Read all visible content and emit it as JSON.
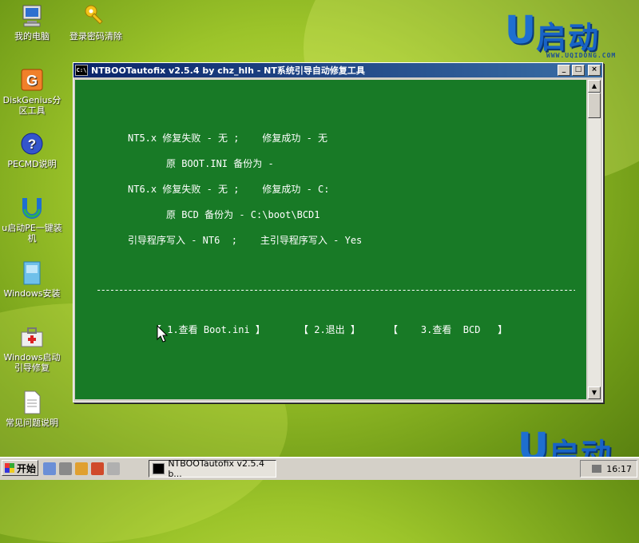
{
  "desktop": {
    "icons": [
      {
        "label": "我的电脑",
        "icon": "computer-icon"
      },
      {
        "label": "登录密码清除",
        "icon": "key-icon"
      },
      {
        "label": "DiskGenius分区工具",
        "icon": "diskgenius-icon"
      },
      {
        "label": "PECMD说明",
        "icon": "help-icon"
      },
      {
        "label": "u启动PE一键装机",
        "icon": "u-logo-icon"
      },
      {
        "label": "Windows安装",
        "icon": "windows-install-icon"
      },
      {
        "label": "Windows启动引导修复",
        "icon": "toolbox-icon"
      },
      {
        "label": "常见问题说明",
        "icon": "document-icon"
      }
    ],
    "logo": {
      "brand": "启动",
      "url": "WWW.UQIDONG.COM"
    }
  },
  "window": {
    "title": "NTBOOTautofix v2.5.4 by chz_hlh - NT系统引导自动修复工具",
    "minimize": "_",
    "maximize": "□",
    "close": "×"
  },
  "console": {
    "lines": [
      "NT5.x 修复失败 - 无 ;    修复成功 - 无",
      "原 BOOT.INI 备份为 -",
      "NT6.x 修复失败 - 无 ;    修复成功 - C:",
      "原 BCD 备份为 - C:\\boot\\BCD1",
      "引导程序写入 - NT6  ;    主引导程序写入 - Yes"
    ],
    "separator": "--------------------------------------------------------------------------------------------------------------",
    "menu": [
      "【 1.查看 Boot.ini 】",
      "【 2.退出 】",
      "【    3.查看  BCD   】"
    ]
  },
  "taskbar": {
    "start_label": "开始",
    "task_label": "NTBOOTautofix v2.5.4 b...",
    "clock": "16:17"
  }
}
